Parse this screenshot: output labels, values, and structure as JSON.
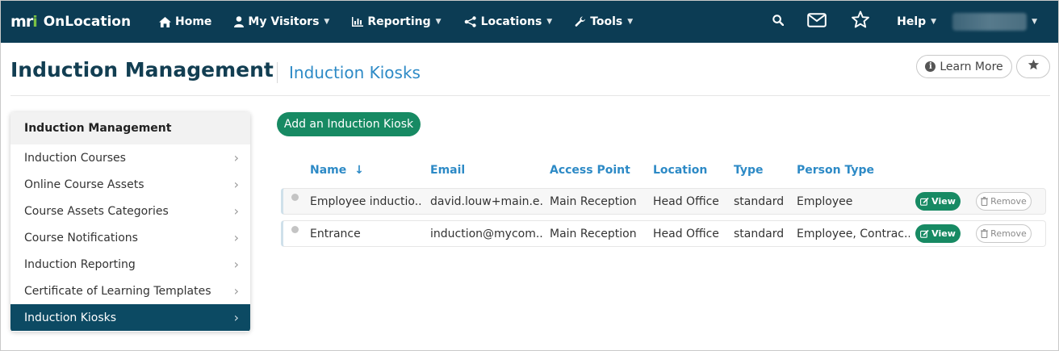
{
  "nav": {
    "brand_logo": "mri",
    "brand_name": "OnLocation",
    "items": [
      {
        "label": "Home",
        "icon": "home-icon",
        "caret": false
      },
      {
        "label": "My Visitors",
        "icon": "user-icon",
        "caret": true
      },
      {
        "label": "Reporting",
        "icon": "bar-chart-icon",
        "caret": true
      },
      {
        "label": "Locations",
        "icon": "sitemap-icon",
        "caret": true
      },
      {
        "label": "Tools",
        "icon": "wrench-icon",
        "caret": true
      }
    ],
    "help_label": "Help",
    "accent_color": "#0c3c54"
  },
  "header": {
    "title": "Induction Management",
    "subtitle": "Induction Kiosks",
    "learn_more_label": "Learn More"
  },
  "sidebar": {
    "heading": "Induction Management",
    "items": [
      {
        "label": "Induction Courses",
        "active": false
      },
      {
        "label": "Online Course Assets",
        "active": false
      },
      {
        "label": "Course Assets Categories",
        "active": false
      },
      {
        "label": "Course Notifications",
        "active": false
      },
      {
        "label": "Induction Reporting",
        "active": false
      },
      {
        "label": "Certificate of Learning Templates",
        "active": false
      },
      {
        "label": "Induction Kiosks",
        "active": true
      }
    ]
  },
  "main": {
    "add_button_label": "Add an Induction Kiosk",
    "columns": [
      "Name",
      "Email",
      "Access Point",
      "Location",
      "Type",
      "Person Type"
    ],
    "sort_indicator": "↓",
    "rows": [
      {
        "name": "Employee inductio...",
        "email": "david.louw+main.e...",
        "access_point": "Main Reception",
        "location": "Head Office",
        "type": "standard",
        "person_type": "Employee"
      },
      {
        "name": "Entrance",
        "email": "induction@mycom...",
        "access_point": "Main Reception",
        "location": "Head Office",
        "type": "standard",
        "person_type": "Employee, Contrac..."
      }
    ],
    "view_label": "View",
    "remove_label": "Remove",
    "primary_color": "#178a63",
    "link_color": "#2d8ac6"
  }
}
